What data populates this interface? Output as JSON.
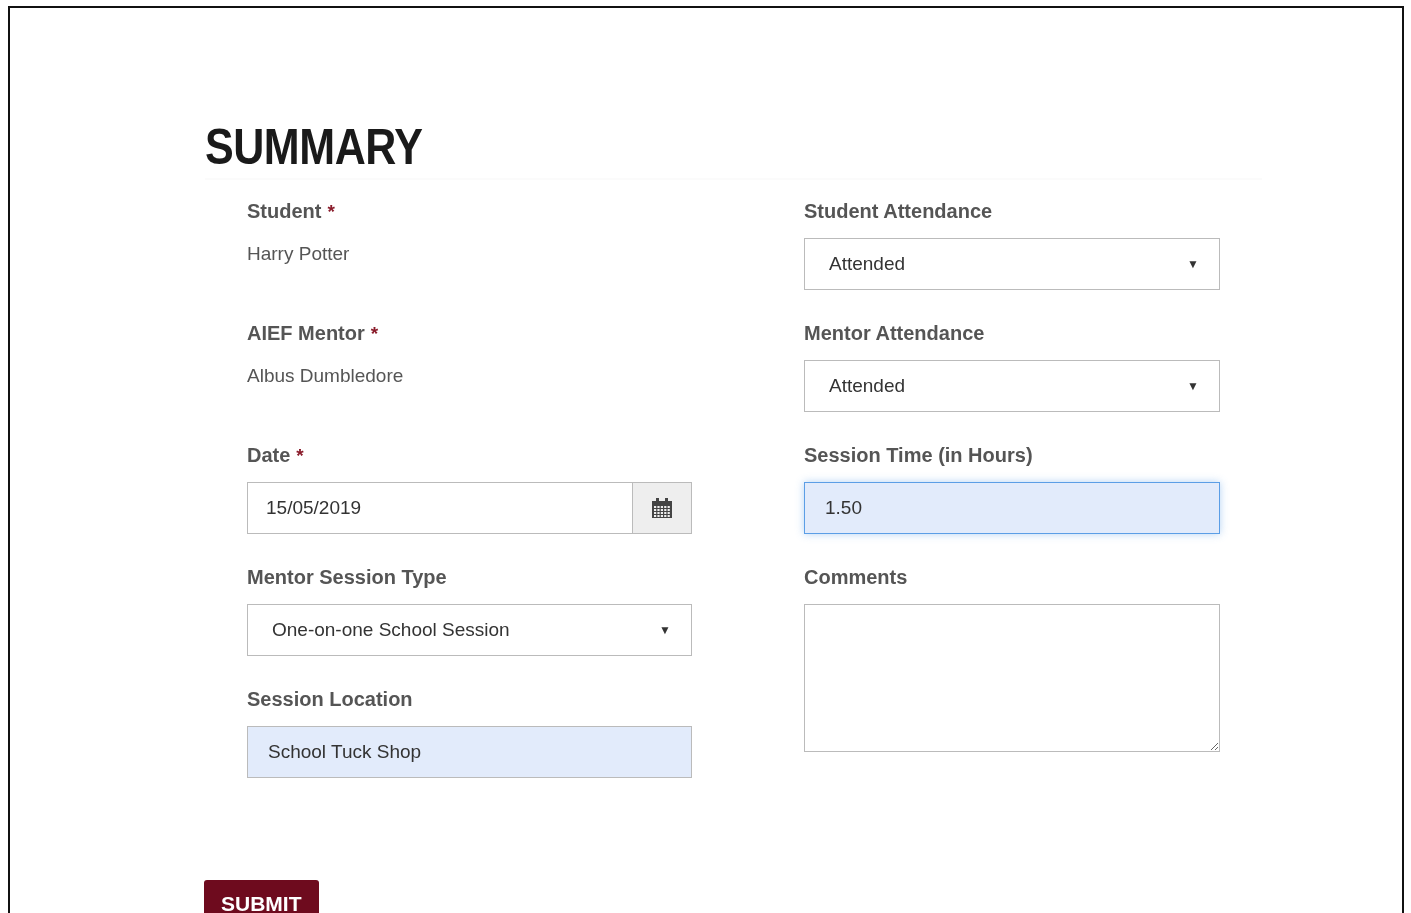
{
  "title": "SUMMARY",
  "required_marker": "*",
  "columns": [
    [
      {
        "kind": "static",
        "label": "Student",
        "required": true,
        "value": "Harry Potter"
      },
      {
        "kind": "static",
        "label": "AIEF Mentor",
        "required": true,
        "value": "Albus Dumbledore"
      },
      {
        "kind": "date",
        "label": "Date",
        "required": true,
        "value": "15/05/2019"
      },
      {
        "kind": "select",
        "label": "Mentor Session Type",
        "required": false,
        "value": "One-on-one School Session",
        "caret": "▼"
      },
      {
        "kind": "text",
        "label": "Session Location",
        "required": false,
        "value": "School Tuck Shop",
        "autofilled": true,
        "focused": false
      }
    ],
    [
      {
        "kind": "select",
        "label": "Student Attendance",
        "required": false,
        "value": "Attended",
        "caret": "▼"
      },
      {
        "kind": "select",
        "label": "Mentor Attendance",
        "required": false,
        "value": "Attended",
        "caret": "▼"
      },
      {
        "kind": "text",
        "label": "Session Time (in Hours)",
        "required": false,
        "value": "1.50",
        "autofilled": true,
        "focused": true
      },
      {
        "kind": "textarea",
        "label": "Comments",
        "required": false
      }
    ]
  ],
  "submit": "SUBMIT"
}
